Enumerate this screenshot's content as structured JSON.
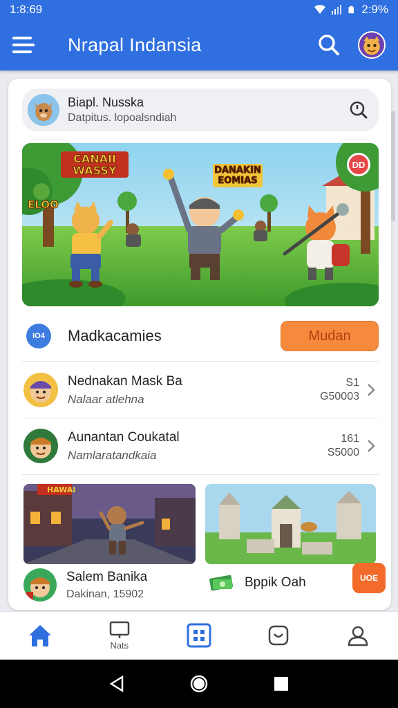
{
  "status_bar": {
    "time": "1:8:69",
    "battery": "2:9%"
  },
  "app_bar": {
    "title": "Nrapal Indansia"
  },
  "top_card": {
    "title": "Biapl. Nusska",
    "subtitle": "Datpitus. lopoalsndiah"
  },
  "hero": {
    "badge": "DD",
    "sign_left": "CANAII WASSY",
    "sign_right": "DANAKIN EOMIAS",
    "sign_small": "ELOO"
  },
  "section": {
    "icon_text": "IO4",
    "title": "Madkacamies",
    "button": "Mudan"
  },
  "list": [
    {
      "title": "Nednakan Mask Ba",
      "subtitle": "Nalaar atlehna",
      "meta_top": "S1",
      "meta_bottom": "G50003"
    },
    {
      "title": "Aunantan Coukatal",
      "subtitle": "Namlaratandkaia",
      "meta_top": "161",
      "meta_bottom": "S5000"
    }
  ],
  "thumbs": [
    {
      "title": "Salem Banika",
      "subtitle": "Dakinan, 15902",
      "sign": "HAWAI"
    },
    {
      "title": "Bppik Oah"
    }
  ],
  "corner_badge": "UOE",
  "bottom_nav": [
    {
      "label": ""
    },
    {
      "label": "Nats"
    },
    {
      "label": ""
    },
    {
      "label": ""
    },
    {
      "label": ""
    }
  ],
  "colors": {
    "primary": "#2f6fe0",
    "accent": "#f58a3c",
    "active_nav": "#2f6fe0"
  }
}
